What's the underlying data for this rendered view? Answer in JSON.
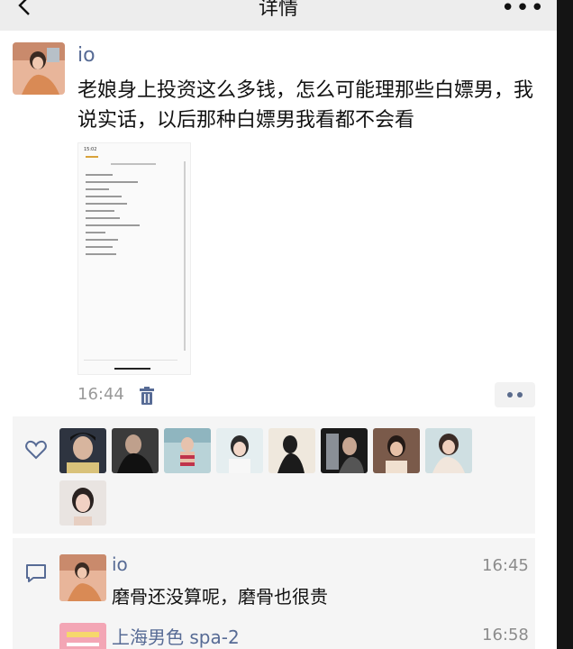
{
  "nav": {
    "title": "详情",
    "more_icon": "more-icon",
    "back_icon": "back-chevron-icon"
  },
  "post": {
    "username": "io",
    "text": "老娘身上投资这么多钱，怎么可能理那些白嫖男，我说实话，以后那种白嫖男我看都不会看",
    "time": "16:44",
    "screenshot": {
      "status_text": "15:02",
      "note_lines": 14
    },
    "like_count": 9
  },
  "comments": [
    {
      "name": "io",
      "time": "16:45",
      "text": "磨骨还没算呢，磨骨也很贵"
    },
    {
      "name": "上海男色 spa-2",
      "time": "16:58",
      "text": ""
    }
  ],
  "colors": {
    "name_blue": "#576b95",
    "panel_bg": "#f5f5f5",
    "nav_bg": "#ededed"
  },
  "icons": [
    "back-chevron-icon",
    "more-icon",
    "trash-icon",
    "heart-icon",
    "comment-icon",
    "action-dots-icon"
  ]
}
